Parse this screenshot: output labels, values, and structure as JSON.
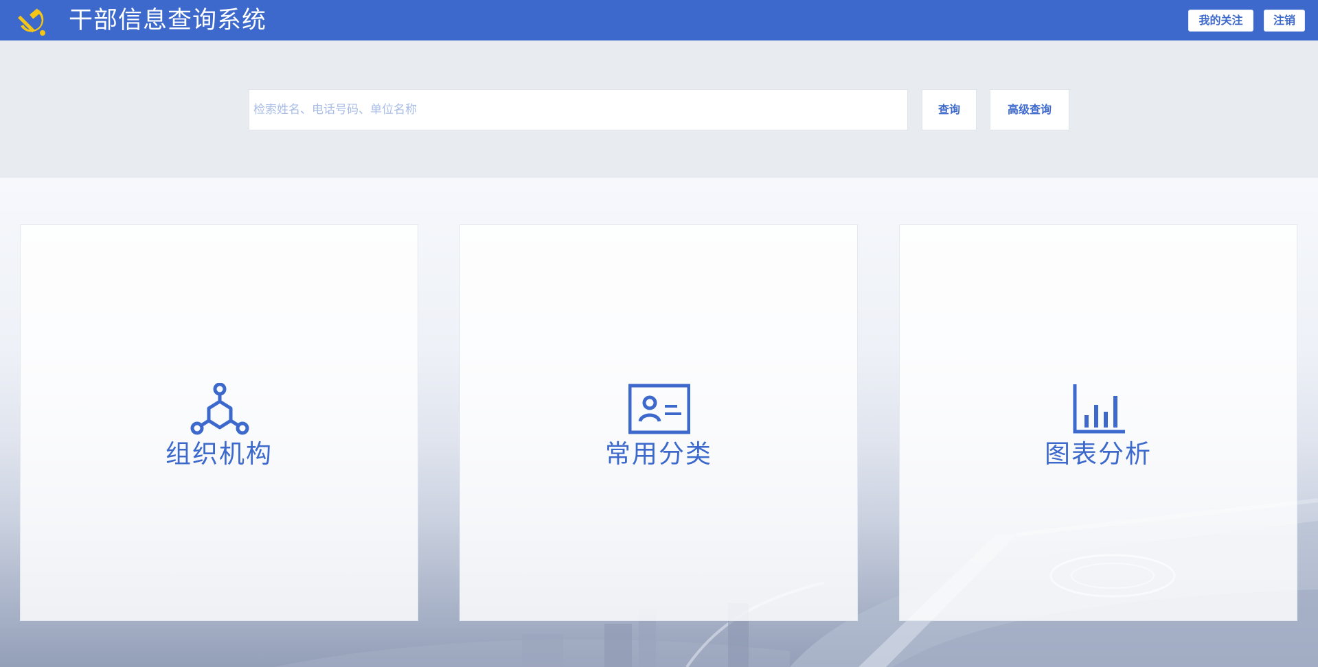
{
  "header": {
    "title": "干部信息查询系统",
    "logo_icon": "hammer-sickle-icon",
    "follow_label": "我的关注",
    "logout_label": "注销",
    "bg_color": "#3c69cb",
    "logo_color": "#f5c518"
  },
  "search": {
    "placeholder": "检索姓名、电话号码、单位名称",
    "value": "",
    "query_label": "查询",
    "advanced_label": "高级查询"
  },
  "cards": [
    {
      "label": "组织机构",
      "icon": "org-structure-icon"
    },
    {
      "label": "常用分类",
      "icon": "id-card-icon"
    },
    {
      "label": "图表分析",
      "icon": "bar-chart-icon"
    }
  ],
  "accent_color": "#3c69cb"
}
